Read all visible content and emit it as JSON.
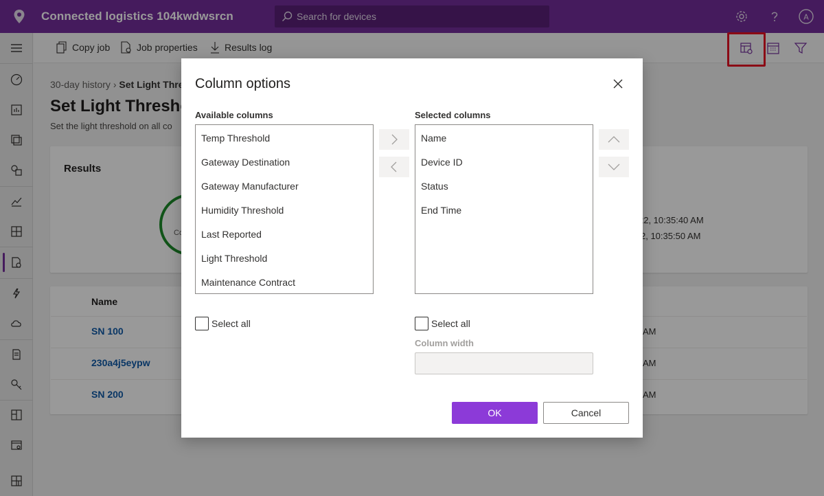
{
  "header": {
    "app_title": "Connected logistics 104kwdwsrcn",
    "search_placeholder": "Search for devices",
    "icons": [
      "location-pin-icon",
      "settings-icon",
      "help-icon",
      "account-icon"
    ]
  },
  "commands": {
    "copy_job": "Copy job",
    "job_properties": "Job properties",
    "results_log": "Results log",
    "right_icons": [
      "column-options-icon",
      "calendar-icon",
      "filter-icon"
    ]
  },
  "page": {
    "breadcrumb_root": "30-day history",
    "breadcrumb_current": "Set Light Thre",
    "title": "Set Light Thresho",
    "description": "Set the light threshold on all co",
    "results_label": "Results",
    "ring_text": "Co",
    "timestamp_1": "22, 10:35:40 AM",
    "timestamp_2": "2, 10:35:50 AM",
    "column_name": "Name",
    "rows": [
      {
        "name": "SN 100",
        "tail": "AM"
      },
      {
        "name": "230a4j5eypw",
        "tail": "AM"
      },
      {
        "name": "SN 200",
        "tail": "AM"
      }
    ]
  },
  "dialog": {
    "title": "Column options",
    "available_label": "Available columns",
    "selected_label": "Selected columns",
    "available": [
      "Temp Threshold",
      "Gateway Destination",
      "Gateway Manufacturer",
      "Humidity Threshold",
      "Last Reported",
      "Light Threshold",
      "Maintenance Contract"
    ],
    "selected": [
      "Name",
      "Device ID",
      "Status",
      "End Time"
    ],
    "select_all_left": "Select all",
    "select_all_right": "Select all",
    "column_width_label": "Column width",
    "ok": "OK",
    "cancel": "Cancel"
  },
  "colors": {
    "brand": "#742e9b",
    "primary_button": "#8c3ad8",
    "highlight": "#e81123",
    "success_ring": "#1d8c2a",
    "link": "#0f5aa8"
  }
}
